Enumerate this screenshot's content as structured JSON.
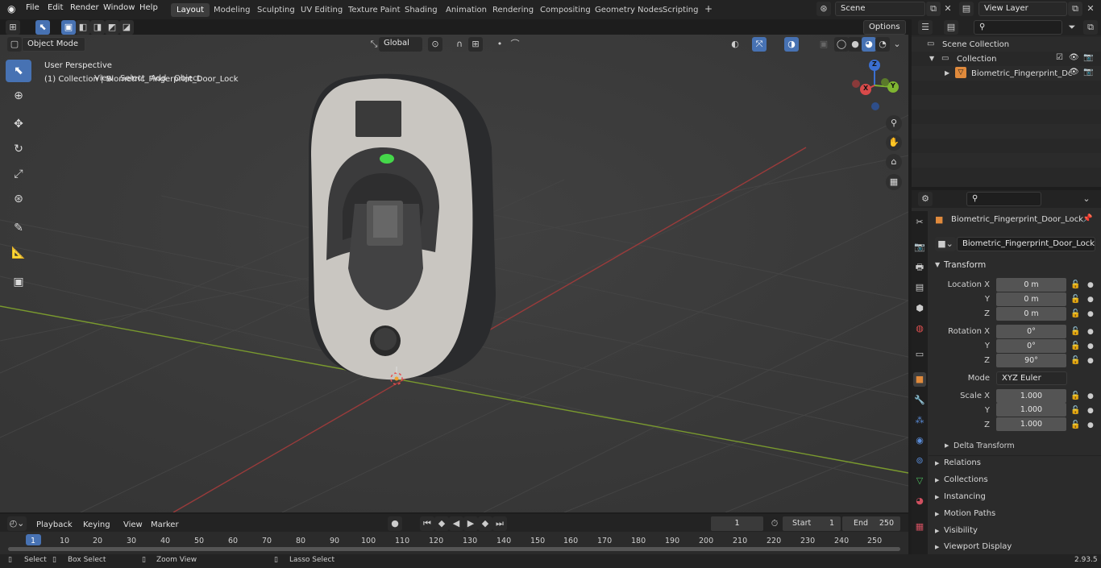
{
  "topbar": {
    "menus": [
      "File",
      "Edit",
      "Render",
      "Window",
      "Help"
    ],
    "workspaces": [
      "Layout",
      "Modeling",
      "Sculpting",
      "UV Editing",
      "Texture Paint",
      "Shading",
      "Animation",
      "Rendering",
      "Compositing",
      "Geometry Nodes",
      "Scripting"
    ],
    "active_workspace": "Layout",
    "scene": "Scene",
    "view_layer": "View Layer"
  },
  "viewport_header": {
    "mode": "Object Mode",
    "menus": [
      "View",
      "Select",
      "Add",
      "Object"
    ],
    "orientation": "Global",
    "options": "Options"
  },
  "viewport": {
    "perspective": "User Perspective",
    "collection_info": "(1) Collection | Biometric_Fingerprint_Door_Lock",
    "gizmo": {
      "z": "Z",
      "y": "Y",
      "x": "X"
    }
  },
  "outliner": {
    "scene_collection": "Scene Collection",
    "collection": "Collection",
    "object": "Biometric_Fingerprint_Dc"
  },
  "properties": {
    "object_name": "Biometric_Fingerprint_Door_Lock",
    "data_name": "Biometric_Fingerprint_Door_Lock",
    "transform": "Transform",
    "location_label": "Location X",
    "rotation_label": "Rotation X",
    "scale_label": "Scale X",
    "y": "Y",
    "z": "Z",
    "location": [
      "0 m",
      "0 m",
      "0 m"
    ],
    "rotation": [
      "0°",
      "0°",
      "90°"
    ],
    "mode_label": "Mode",
    "mode": "XYZ Euler",
    "scale": [
      "1.000",
      "1.000",
      "1.000"
    ],
    "delta": "Delta Transform",
    "sections": [
      "Relations",
      "Collections",
      "Instancing",
      "Motion Paths",
      "Visibility",
      "Viewport Display"
    ]
  },
  "timeline": {
    "menus": [
      "Playback",
      "Keying",
      "View",
      "Marker"
    ],
    "current_frame": "1",
    "start_label": "Start",
    "start": "1",
    "end_label": "End",
    "end": "250",
    "ticks": [
      "1",
      "10",
      "20",
      "30",
      "40",
      "50",
      "60",
      "70",
      "80",
      "90",
      "100",
      "110",
      "120",
      "130",
      "140",
      "150",
      "160",
      "170",
      "180",
      "190",
      "200",
      "210",
      "220",
      "230",
      "240",
      "250"
    ]
  },
  "statusbar": {
    "select": "Select",
    "box_select": "Box Select",
    "zoom_view": "Zoom View",
    "lasso_select": "Lasso Select",
    "version": "2.93.5"
  }
}
